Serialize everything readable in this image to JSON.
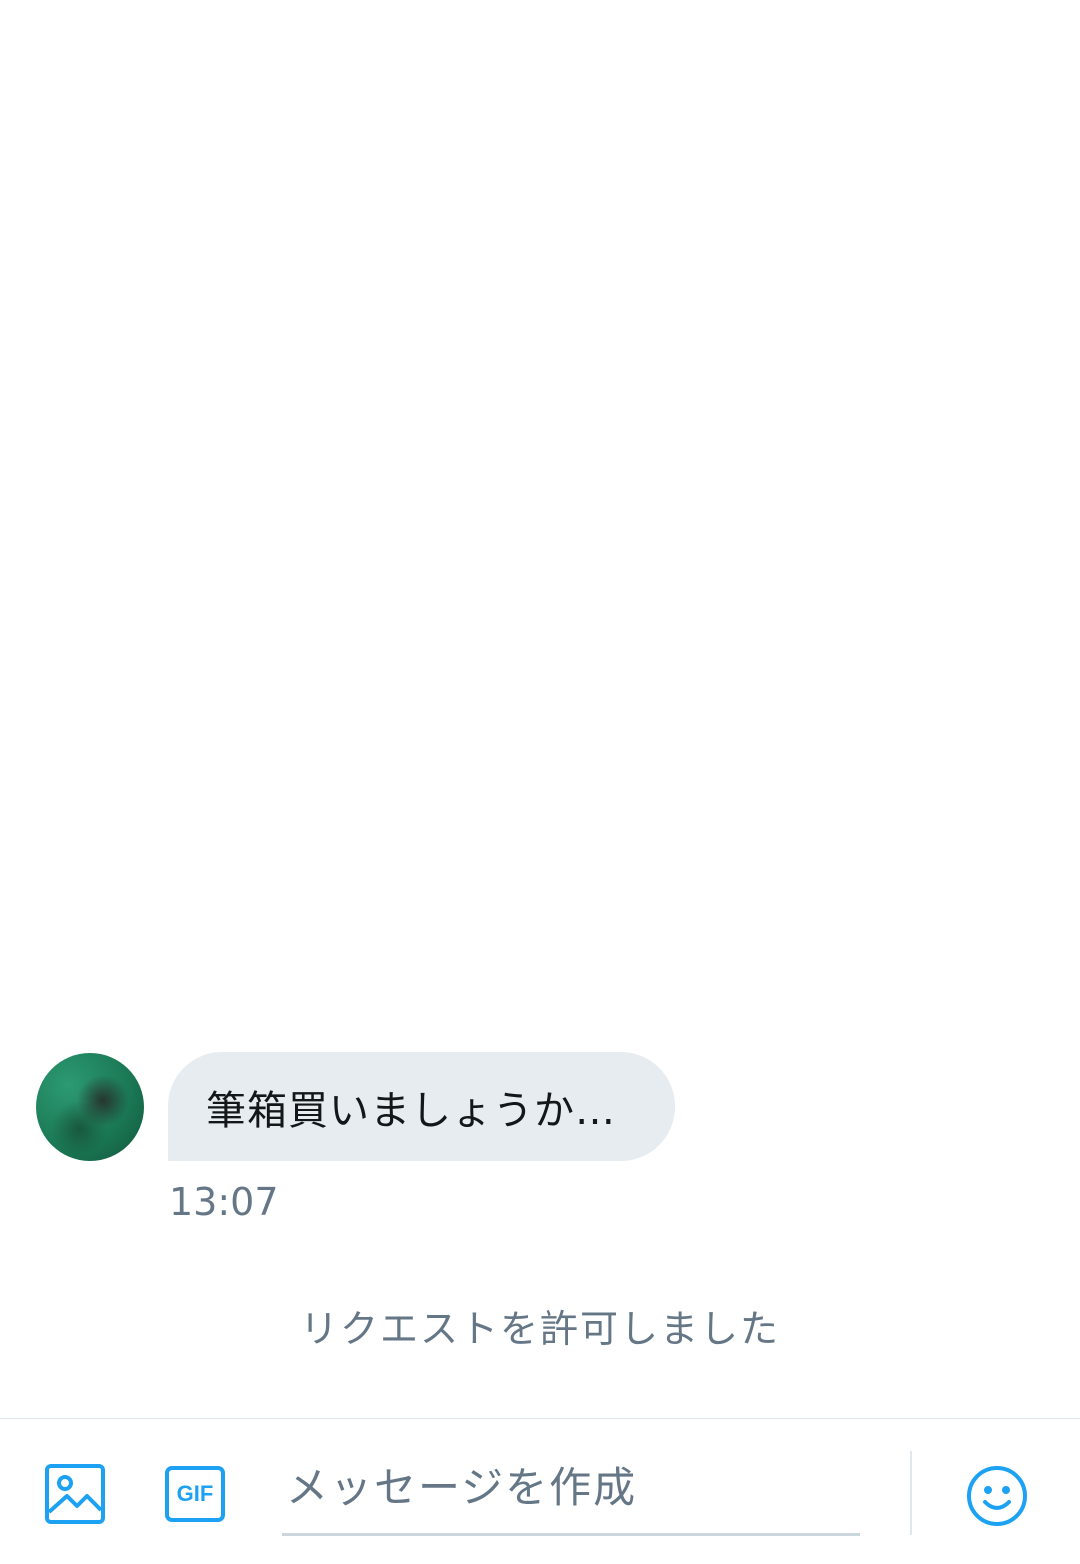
{
  "conversation": {
    "messages": [
      {
        "sender": "other",
        "text": "筆箱買いましょうか…",
        "time": "13:07"
      }
    ],
    "system_message": "リクエストを許可しました"
  },
  "composer": {
    "input_placeholder": "メッセージを作成",
    "input_value": "",
    "gif_label": "GIF",
    "icons": {
      "media": "image-icon",
      "gif": "gif-icon",
      "emoji": "emoji-icon"
    }
  },
  "colors": {
    "accent": "#1da1f2",
    "bubble_background": "#e6ecf0",
    "secondary_text": "#657786",
    "primary_text": "#14171a",
    "border": "#e1e8ed"
  }
}
